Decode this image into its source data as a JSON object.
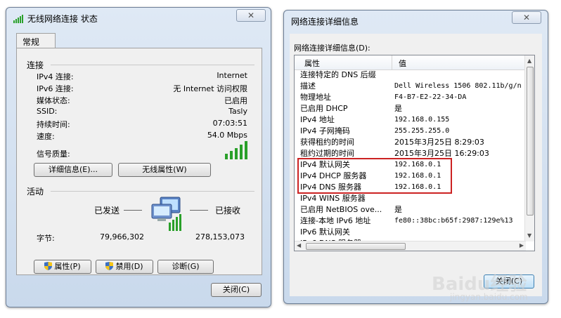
{
  "left_window": {
    "title": "无线网络连接 状态",
    "close_label": "✕",
    "tab": "常规",
    "connection_heading": "连接",
    "rows": [
      {
        "k": "IPv4 连接:",
        "v": "Internet"
      },
      {
        "k": "IPv6 连接:",
        "v": "无 Internet 访问权限"
      },
      {
        "k": "媒体状态:",
        "v": "已启用"
      },
      {
        "k": "SSID:",
        "v": "Tasly"
      },
      {
        "k": "持续时间:",
        "v": "07:03:51"
      },
      {
        "k": "速度:",
        "v": "54.0 Mbps"
      }
    ],
    "signal_label": "信号质量:",
    "details_button": "详细信息(E)...",
    "wireless_props_button": "无线属性(W)",
    "activity_heading": "活动",
    "sent_label": "已发送",
    "received_label": "已接收",
    "bytes_label": "字节:",
    "bytes_sent": "79,966,302",
    "bytes_received": "278,153,073",
    "properties_button": "属性(P)",
    "disable_button": "禁用(D)",
    "diagnose_button": "诊断(G)",
    "close_button": "关闭(C)"
  },
  "right_window": {
    "title": "网络连接详细信息",
    "group_label": "网络连接详细信息(D):",
    "col_property": "属性",
    "col_value": "值",
    "rows": [
      {
        "k": "连接特定的 DNS 后缀",
        "v": ""
      },
      {
        "k": "描述",
        "v": "Dell Wireless 1506 802.11b/g/n"
      },
      {
        "k": "物理地址",
        "v": "F4-B7-E2-22-34-DA"
      },
      {
        "k": "已启用 DHCP",
        "v": "是"
      },
      {
        "k": "IPv4 地址",
        "v": "192.168.0.155"
      },
      {
        "k": "IPv4 子网掩码",
        "v": "255.255.255.0"
      },
      {
        "k": "获得租约的时间",
        "v": "2015年3月25日 8:29:03"
      },
      {
        "k": "租约过期的时间",
        "v": "2015年3月25日 16:29:03"
      },
      {
        "k": "IPv4 默认网关",
        "v": "192.168.0.1"
      },
      {
        "k": "IPv4 DHCP 服务器",
        "v": "192.168.0.1"
      },
      {
        "k": "IPv4 DNS 服务器",
        "v": "192.168.0.1"
      },
      {
        "k": "IPv4 WINS 服务器",
        "v": ""
      },
      {
        "k": "已启用 NetBIOS ove...",
        "v": "是"
      },
      {
        "k": "连接-本地 IPv6 地址",
        "v": "fe80::38bc:b65f:2987:129e%13"
      },
      {
        "k": "IPv6 默认网关",
        "v": ""
      },
      {
        "k": "IPv6 DNS 服务器",
        "v": ""
      }
    ],
    "close_button": "关闭(C)",
    "close_label": "✕"
  },
  "watermark": {
    "brand": "Baidu经验",
    "url": "jingyan.baidu.com"
  },
  "colors": {
    "highlight_border": "#cc2222",
    "signal_green": "#2aa02a",
    "frame": "#6d7f97"
  }
}
